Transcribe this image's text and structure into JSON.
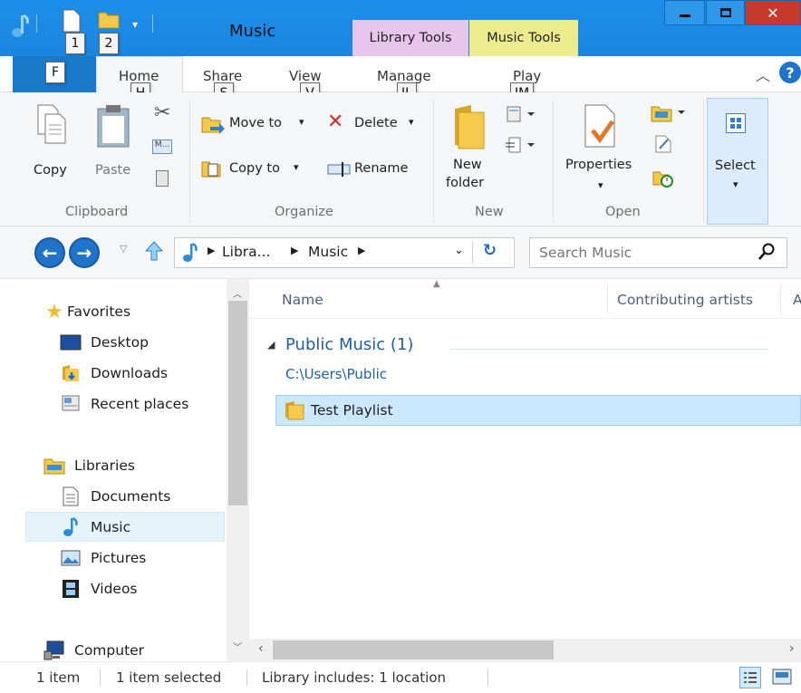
{
  "window": {
    "title": "Music",
    "context_tabs": [
      "Library Tools",
      "Music Tools"
    ]
  },
  "qat": {
    "keytips": [
      "1",
      "2"
    ]
  },
  "ribbon_tabs": {
    "file_keytip": "F",
    "home": "Home",
    "home_keytip": "H",
    "share": "Share",
    "share_keytip": "S",
    "view": "View",
    "view_keytip": "V",
    "manage": "Manage",
    "manage_keytip": "JL",
    "play": "Play",
    "play_keytip": "JM"
  },
  "ribbon": {
    "clipboard": {
      "label": "Clipboard",
      "copy": "Copy",
      "paste": "Paste"
    },
    "organize": {
      "label": "Organize",
      "move_to": "Move to",
      "copy_to": "Copy to",
      "delete": "Delete",
      "rename": "Rename"
    },
    "new": {
      "label": "New",
      "new_folder_line1": "New",
      "new_folder_line2": "folder"
    },
    "open": {
      "label": "Open",
      "properties": "Properties"
    },
    "select": {
      "select": "Select"
    }
  },
  "address": {
    "crumbs": [
      "Libra...",
      "Music"
    ],
    "search_placeholder": "Search Music"
  },
  "nav": {
    "favorites": "Favorites",
    "desktop": "Desktop",
    "downloads": "Downloads",
    "recent": "Recent places",
    "libraries": "Libraries",
    "documents": "Documents",
    "music": "Music",
    "pictures": "Pictures",
    "videos": "Videos",
    "computer": "Computer"
  },
  "content": {
    "columns": [
      "Name",
      "Contributing artists",
      "A"
    ],
    "group_title": "Public Music (1)",
    "group_path": "C:\\Users\\Public",
    "items": [
      "Test Playlist"
    ]
  },
  "status": {
    "count": "1 item",
    "selected": "1 item selected",
    "library": "Library includes: 1 location"
  },
  "colors": {
    "titlebar": "#1b86e0",
    "library_tools": "#e8c5ec",
    "music_tools": "#ecec8e",
    "selection": "#cce8ff",
    "group_title": "#1e5fa8"
  }
}
